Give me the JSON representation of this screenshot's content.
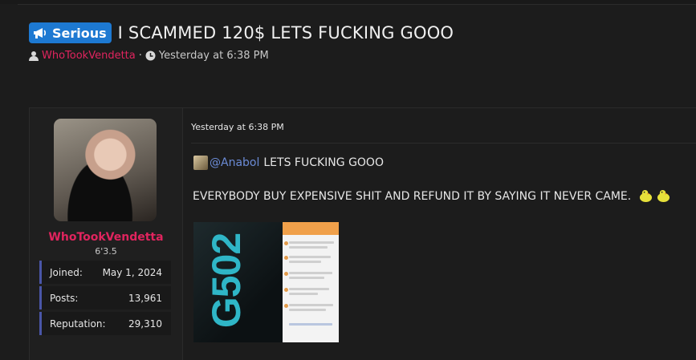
{
  "thread": {
    "prefix": "Serious",
    "title": "I SCAMMED 120$ LETS FUCKING GOOO",
    "author": "WhoTookVendetta",
    "separator": "·",
    "time": "Yesterday at 6:38 PM"
  },
  "post": {
    "date": "Yesterday at 6:38 PM",
    "mention": "@Anabol",
    "reply_text": "LETS FUCKING GOOO",
    "body": "EVERYBODY BUY EXPENSIVE SHIT AND REFUND IT BY SAYING IT NEVER CAME.",
    "attachment_box_text": "G502"
  },
  "user": {
    "name": "WhoTookVendetta",
    "title": "6'3.5",
    "stats": [
      {
        "label": "Joined:",
        "value": "May 1, 2024"
      },
      {
        "label": "Posts:",
        "value": "13,961"
      },
      {
        "label": "Reputation:",
        "value": "29,310"
      }
    ]
  },
  "colors": {
    "prefix_bg": "#1d79d2",
    "username": "#e0245e",
    "mention": "#6b8bd6",
    "stat_accent": "#4a56a8"
  },
  "icons": [
    "megaphone-icon",
    "user-icon",
    "clock-icon",
    "emoji-icon"
  ]
}
